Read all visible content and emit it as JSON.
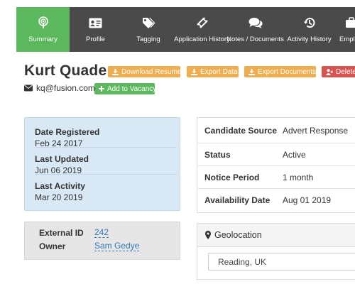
{
  "nav": {
    "tabs": [
      {
        "label": "Summary",
        "icon": "podcast-icon",
        "active": true
      },
      {
        "label": "Profile",
        "icon": "id-card-icon",
        "active": false
      },
      {
        "label": "Tagging",
        "icon": "tags-icon",
        "active": false
      },
      {
        "label": "Application History",
        "icon": "ticket-icon",
        "active": false
      },
      {
        "label": "Notes / Documents",
        "icon": "comments-icon",
        "active": false
      },
      {
        "label": "Activity History",
        "icon": "history-icon",
        "active": false
      },
      {
        "label": "Employ",
        "icon": "briefcase-icon",
        "active": false
      }
    ]
  },
  "candidate": {
    "name": "Kurt Quade",
    "email": "kq@fusion.com"
  },
  "actions": {
    "download_resume": "Download Resume",
    "export_data": "Export Data",
    "export_documents": "Export Documents",
    "delete": "Delete",
    "add_to_vacancy": "Add to Vacancy"
  },
  "dates": {
    "registered_label": "Date Registered",
    "registered": "Feb 24 2017",
    "updated_label": "Last Updated",
    "updated": "Jun 06 2019",
    "activity_label": "Last Activity",
    "activity": "Mar 20 2019"
  },
  "meta": {
    "external_id_label": "External ID",
    "external_id": "242",
    "owner_label": "Owner",
    "owner": "Sam Gedye"
  },
  "details": {
    "source_label": "Candidate Source",
    "source": "Advert Response",
    "status_label": "Status",
    "status": "Active",
    "notice_label": "Notice Period",
    "notice": "1 month",
    "availability_label": "Availability Date",
    "availability": "Aug 01 2019"
  },
  "geolocation": {
    "title": "Geolocation",
    "value": "Reading, UK"
  },
  "colors": {
    "nav_bg": "#4a4a4a",
    "nav_active": "#5cb85c",
    "warning": "#f0ad4e",
    "danger": "#d9534f",
    "success": "#5cb85c",
    "link": "#337ab7",
    "info_panel": "#d9e8f5"
  }
}
